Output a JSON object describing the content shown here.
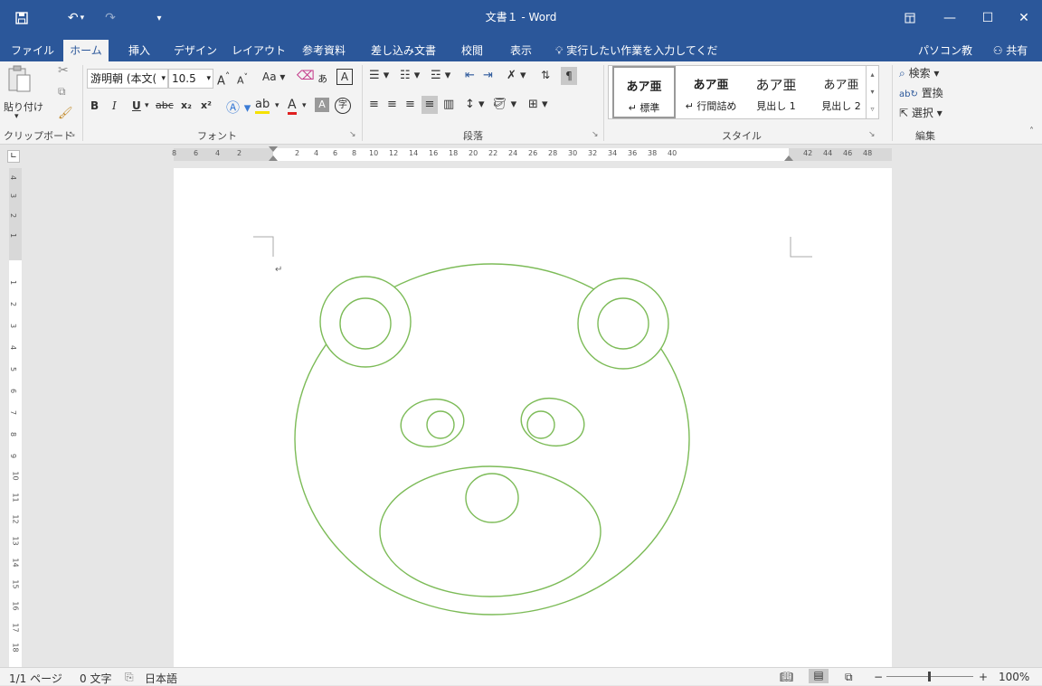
{
  "window": {
    "title": "文書１ - Word"
  },
  "tabs": [
    {
      "label": "ファイル"
    },
    {
      "label": "ホーム"
    },
    {
      "label": "挿入"
    },
    {
      "label": "デザイン"
    },
    {
      "label": "レイアウト"
    },
    {
      "label": "参考資料"
    },
    {
      "label": "差し込み文書"
    },
    {
      "label": "校閲"
    },
    {
      "label": "表示"
    }
  ],
  "tell_me": "実行したい作業を入力してください",
  "account": {
    "name": "パソコン教室",
    "share": "共有"
  },
  "clipboard": {
    "paste": "貼り付け",
    "label": "クリップボード"
  },
  "font": {
    "name": "游明朝 (本文(",
    "size": "10.5",
    "label": "フォント",
    "change_case": "Aa",
    "bold": "B",
    "italic": "I",
    "underline": "U",
    "strike": "abc",
    "subscript": "x₂",
    "superscript": "x²",
    "grow": "A",
    "shrink": "A",
    "enclose": "字"
  },
  "paragraph": {
    "label": "段落"
  },
  "styles": {
    "label": "スタイル",
    "items": [
      {
        "preview": "あア亜",
        "name": "↵ 標準"
      },
      {
        "preview": "あア亜",
        "name": "↵ 行間詰め"
      },
      {
        "preview": "あア亜",
        "name": "見出し 1"
      },
      {
        "preview": "あア亜",
        "name": "見出し 2"
      }
    ]
  },
  "editing": {
    "find": "検索",
    "replace": "置換",
    "select": "選択",
    "label": "編集"
  },
  "ruler": {
    "h_left": [
      "8",
      "6",
      "4",
      "2"
    ],
    "h_main": [
      "2",
      "4",
      "6",
      "8",
      "10",
      "12",
      "14",
      "16",
      "18",
      "20",
      "22",
      "24",
      "26",
      "28",
      "30",
      "32",
      "34",
      "36",
      "38",
      "40"
    ],
    "h_right": [
      "42",
      "44",
      "46",
      "48"
    ],
    "v_top": [
      "4",
      "3",
      "2",
      "1"
    ],
    "v_main": [
      "1",
      "2",
      "3",
      "4",
      "5",
      "6",
      "7",
      "8",
      "9",
      "10",
      "11",
      "12",
      "13",
      "14",
      "15",
      "16",
      "17",
      "18"
    ]
  },
  "status": {
    "page": "1/1 ページ",
    "words": "0 文字",
    "language": "日本語",
    "zoom": "100%"
  },
  "colors": {
    "accent": "#2b579a",
    "shape_stroke": "#7cbb57"
  }
}
